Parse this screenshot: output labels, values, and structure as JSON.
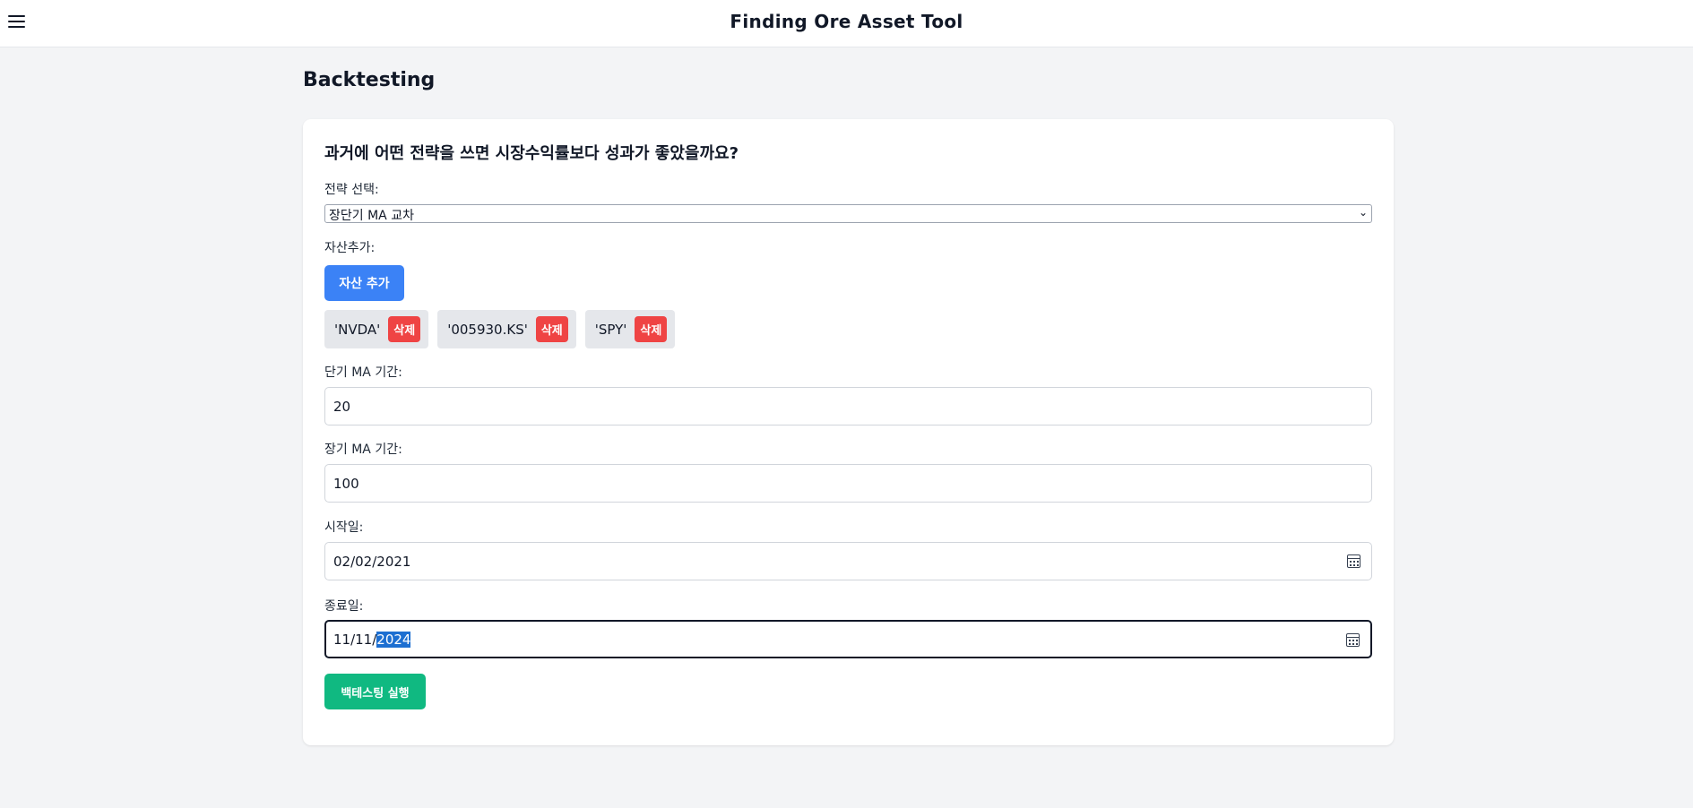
{
  "header": {
    "title": "Finding Ore Asset Tool"
  },
  "page": {
    "title": "Backtesting"
  },
  "form": {
    "question": "과거에 어떤 전략을 쓰면 시장수익률보다 성과가 좋았을까요?",
    "strategy_label": "전략 선택:",
    "strategy_value": "장단기 MA 교차",
    "assets_label": "자산추가:",
    "add_asset_button": "자산 추가",
    "assets": [
      {
        "name": "'NVDA'",
        "delete_label": "삭제"
      },
      {
        "name": "'005930.KS'",
        "delete_label": "삭제"
      },
      {
        "name": "'SPY'",
        "delete_label": "삭제"
      }
    ],
    "short_ma_label": "단기 MA 기간:",
    "short_ma_value": "20",
    "long_ma_label": "장기 MA 기간:",
    "long_ma_value": "100",
    "start_date_label": "시작일:",
    "start_date_value": "02/02/2021",
    "end_date_label": "종료일:",
    "end_date_prefix": "11/11/",
    "end_date_selected": "2024",
    "run_button": "백테스팅 실행"
  },
  "colors": {
    "add_button": "#3b82f6",
    "delete_button": "#ef4444",
    "run_button": "#10b981",
    "background": "#f3f4f6"
  }
}
